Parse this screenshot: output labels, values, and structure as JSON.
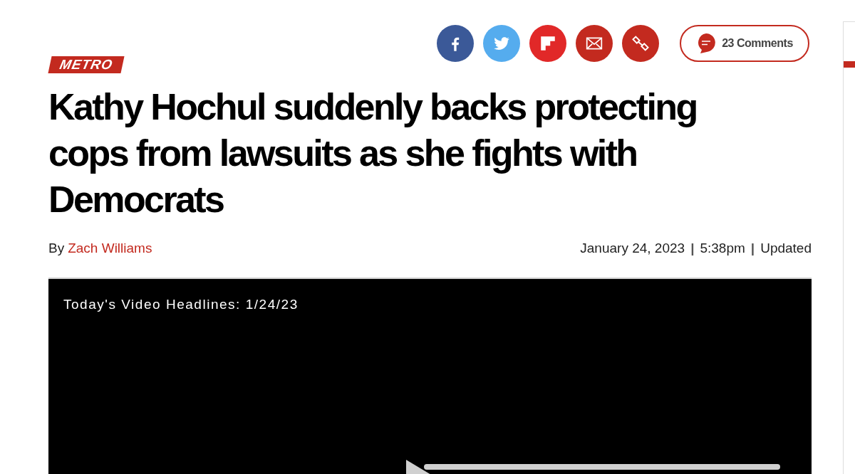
{
  "share_buttons": [
    {
      "kind": "facebook",
      "color": "#3b5998"
    },
    {
      "kind": "twitter",
      "color": "#55acee"
    },
    {
      "kind": "flipboard",
      "color": "#e12828"
    },
    {
      "kind": "email",
      "color": "#c32a1f"
    },
    {
      "kind": "link",
      "color": "#c32a1f"
    }
  ],
  "comments_button": {
    "label": "23 Comments"
  },
  "section_label": "METRO",
  "headline": "Kathy Hochul suddenly backs protecting cops from lawsuits as she fights with Democrats",
  "byline": {
    "prefix": "By",
    "author": "Zach Williams"
  },
  "dateline": [
    {
      "kind": "text",
      "text": "January 24, 2023"
    },
    {
      "kind": "separator",
      "text": "|"
    },
    {
      "kind": "text",
      "text": "5:38pm"
    },
    {
      "kind": "separator",
      "text": "|"
    },
    {
      "kind": "text",
      "text": "Updated"
    }
  ],
  "video": {
    "title": "Today's Video Headlines: 1/24/23"
  }
}
